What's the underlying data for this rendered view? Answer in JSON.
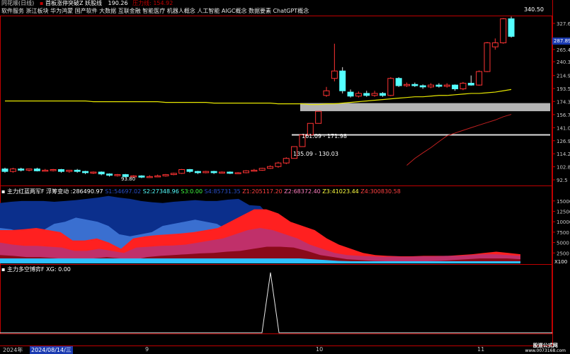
{
  "header": {
    "app_title": "同花顺(日线)",
    "stock_title": "首板涨停突破Z 妖股线",
    "value1": "190.26",
    "value2_label": "压力线",
    "value2": "154.92",
    "concepts": "软件服务 浙江板块 华为鸿蒙 国产软件 大数据 互联金融 智能医疗 机器人概念 人工智能 AIGC概念 数据要素 ChatGPT概念"
  },
  "colors": {
    "up": "#ff3333",
    "down": "#54ffff",
    "ma_yellow": "#e6e600",
    "ma_red": "#c02020",
    "band_gray": "#b4b4b4",
    "axis": "#c00000"
  },
  "price_axis": {
    "ticks": [
      "327.6",
      "287.89",
      "265.4",
      "240.3",
      "214.9",
      "193.5",
      "174.3",
      "156.7",
      "141.0",
      "126.9",
      "114.2",
      "102.8",
      "92.5"
    ],
    "current": "287.89"
  },
  "annotations": {
    "high_label": "340.50",
    "low_label": "93.80",
    "band1": "161.09 - 171.98",
    "band2": "135.09 - 130.03"
  },
  "indicator1": {
    "title": "主力红蓝两军F",
    "subtitle": "浮筹变动",
    "v0": "286490.97",
    "s1_label": "S1",
    "s1": "54697.02",
    "s2_label": "S2",
    "s2": "27348.96",
    "s3_label": "S3",
    "s3": "0.00",
    "s4_label": "S4",
    "s4": "85731.35",
    "z1_label": "Z1",
    "z1": "205117.20",
    "z2_label": "Z2",
    "z2": "68372.40",
    "z3_label": "Z3",
    "z3": "41023.44",
    "z4_label": "Z4",
    "z4": "300830.58",
    "axis_ticks": [
      "15000",
      "12500",
      "10000",
      "7500",
      "5000",
      "2500"
    ],
    "axis_unit": "X100"
  },
  "indicator2": {
    "title": "主力多空博弈F",
    "xg_label": "XG",
    "xg": "0.00"
  },
  "time_axis": {
    "labels": [
      "2024年",
      "2024/08/14/三",
      "9",
      "10",
      "11"
    ]
  },
  "footer": {
    "line1": "股道公式网",
    "line2": "www.0073168.com"
  },
  "chart_data": {
    "type": "candlestick",
    "title": "首板涨停突破Z 妖股线",
    "candles": [
      {
        "o": 101,
        "c": 99,
        "h": 102,
        "l": 98
      },
      {
        "o": 99,
        "c": 101,
        "h": 102,
        "l": 98
      },
      {
        "o": 101,
        "c": 100,
        "h": 102,
        "l": 99
      },
      {
        "o": 100,
        "c": 101,
        "h": 101,
        "l": 99
      },
      {
        "o": 101,
        "c": 99.5,
        "h": 102,
        "l": 99
      },
      {
        "o": 99.5,
        "c": 100,
        "h": 101,
        "l": 99
      },
      {
        "o": 100,
        "c": 100.5,
        "h": 101,
        "l": 99
      },
      {
        "o": 100.5,
        "c": 99,
        "h": 101,
        "l": 98
      },
      {
        "o": 99,
        "c": 100,
        "h": 100,
        "l": 98
      },
      {
        "o": 100,
        "c": 99,
        "h": 101,
        "l": 98
      },
      {
        "o": 99,
        "c": 98,
        "h": 99.5,
        "l": 97
      },
      {
        "o": 98,
        "c": 98.5,
        "h": 99,
        "l": 97
      },
      {
        "o": 98.5,
        "c": 97,
        "h": 99,
        "l": 96
      },
      {
        "o": 97,
        "c": 96,
        "h": 97.5,
        "l": 95
      },
      {
        "o": 96,
        "c": 96.5,
        "h": 97,
        "l": 95
      },
      {
        "o": 96.5,
        "c": 95,
        "h": 97,
        "l": 94.5
      },
      {
        "o": 95,
        "c": 95.5,
        "h": 96,
        "l": 94
      },
      {
        "o": 95.5,
        "c": 94.5,
        "h": 96,
        "l": 93.8
      },
      {
        "o": 94.5,
        "c": 95,
        "h": 96,
        "l": 94
      },
      {
        "o": 95,
        "c": 95.5,
        "h": 96.5,
        "l": 94.5
      },
      {
        "o": 95.5,
        "c": 96.5,
        "h": 97,
        "l": 95
      },
      {
        "o": 96.5,
        "c": 97.5,
        "h": 98,
        "l": 96
      },
      {
        "o": 97.5,
        "c": 100.5,
        "h": 101,
        "l": 97
      },
      {
        "o": 100.5,
        "c": 99,
        "h": 101,
        "l": 98
      },
      {
        "o": 99,
        "c": 98,
        "h": 99.5,
        "l": 97
      },
      {
        "o": 98,
        "c": 99,
        "h": 99.5,
        "l": 97.5
      },
      {
        "o": 99,
        "c": 98,
        "h": 99.5,
        "l": 97
      },
      {
        "o": 98,
        "c": 98.5,
        "h": 99,
        "l": 97.5
      },
      {
        "o": 98.5,
        "c": 97.5,
        "h": 99,
        "l": 97
      },
      {
        "o": 97.5,
        "c": 98,
        "h": 98.5,
        "l": 97
      },
      {
        "o": 98,
        "c": 99.5,
        "h": 100,
        "l": 97.5
      },
      {
        "o": 99.5,
        "c": 100,
        "h": 101,
        "l": 99
      },
      {
        "o": 100,
        "c": 101.5,
        "h": 102,
        "l": 99.5
      },
      {
        "o": 101.5,
        "c": 103,
        "h": 104,
        "l": 101
      },
      {
        "o": 103,
        "c": 106,
        "h": 107,
        "l": 102
      },
      {
        "o": 106,
        "c": 110,
        "h": 111,
        "l": 105
      },
      {
        "o": 110,
        "c": 121,
        "h": 121,
        "l": 110
      },
      {
        "o": 121,
        "c": 133,
        "h": 133,
        "l": 121
      },
      {
        "o": 133,
        "c": 146,
        "h": 146,
        "l": 133
      },
      {
        "o": 146,
        "c": 161,
        "h": 161,
        "l": 146
      },
      {
        "o": 183,
        "c": 190,
        "h": 196,
        "l": 181
      },
      {
        "o": 210,
        "c": 223,
        "h": 278,
        "l": 205
      },
      {
        "o": 223,
        "c": 190,
        "h": 230,
        "l": 186
      },
      {
        "o": 188,
        "c": 182,
        "h": 192,
        "l": 180
      },
      {
        "o": 182,
        "c": 186,
        "h": 189,
        "l": 180
      },
      {
        "o": 186,
        "c": 183,
        "h": 190,
        "l": 181
      },
      {
        "o": 183,
        "c": 186,
        "h": 190,
        "l": 181
      },
      {
        "o": 186,
        "c": 183,
        "h": 188,
        "l": 181
      },
      {
        "o": 183,
        "c": 210,
        "h": 212,
        "l": 182
      },
      {
        "o": 210,
        "c": 198,
        "h": 212,
        "l": 196
      },
      {
        "o": 198,
        "c": 200,
        "h": 203,
        "l": 196
      },
      {
        "o": 200,
        "c": 198,
        "h": 203,
        "l": 196
      },
      {
        "o": 198,
        "c": 196,
        "h": 200,
        "l": 193
      },
      {
        "o": 196,
        "c": 199,
        "h": 202,
        "l": 194
      },
      {
        "o": 199,
        "c": 197,
        "h": 202,
        "l": 195
      },
      {
        "o": 197,
        "c": 199,
        "h": 202,
        "l": 195
      },
      {
        "o": 199,
        "c": 193,
        "h": 200,
        "l": 190
      },
      {
        "o": 193,
        "c": 202,
        "h": 204,
        "l": 191
      },
      {
        "o": 202,
        "c": 199,
        "h": 215,
        "l": 198
      },
      {
        "o": 199,
        "c": 222,
        "h": 224,
        "l": 198
      },
      {
        "o": 222,
        "c": 280,
        "h": 282,
        "l": 221
      },
      {
        "o": 271,
        "c": 280,
        "h": 290,
        "l": 265
      },
      {
        "o": 280,
        "c": 340,
        "h": 342,
        "l": 278
      },
      {
        "o": 340,
        "c": 295,
        "h": 346,
        "l": 292
      }
    ],
    "ma_yellow": [
      175,
      175,
      175,
      175,
      175,
      175,
      175,
      175,
      175,
      175,
      175,
      174,
      174,
      174,
      174,
      174,
      174,
      174,
      174,
      174,
      173,
      173,
      173,
      173,
      173,
      173,
      172,
      172,
      172,
      172,
      172,
      172,
      172,
      172,
      171,
      171,
      171,
      171,
      170,
      170,
      171,
      171,
      172,
      173,
      174,
      175,
      176,
      177,
      178,
      179,
      180,
      181,
      181,
      182,
      183,
      183,
      184,
      185,
      186,
      186,
      187,
      188,
      190,
      192
    ],
    "ma_red": [
      104,
      110,
      115,
      120,
      126,
      132,
      135,
      138,
      141,
      144,
      147,
      150,
      154,
      157
    ],
    "ylim": [
      92.5,
      345
    ],
    "indicator1_series": {
      "dark_blue": [
        145,
        148,
        150,
        150,
        150,
        148,
        150,
        152,
        155,
        158,
        162,
        158,
        155,
        150,
        147,
        145,
        148,
        150,
        152,
        150,
        150,
        153,
        155,
        140,
        138,
        110,
        100,
        85,
        40,
        35,
        30,
        28,
        25,
        22,
        20,
        18,
        18,
        17,
        17,
        17,
        16,
        16,
        18,
        20,
        22,
        20,
        18,
        16,
        15
      ],
      "light_blue": [
        85,
        82,
        75,
        75,
        80,
        95,
        100,
        110,
        105,
        100,
        90,
        70,
        65,
        70,
        75,
        90,
        95,
        100,
        105,
        100,
        95,
        80,
        60,
        40,
        35,
        30,
        25,
        20,
        18,
        16,
        15,
        14,
        14,
        14,
        13,
        13,
        13,
        13,
        14,
        14,
        14,
        14,
        15,
        15,
        15,
        14,
        13,
        12,
        12
      ],
      "red": [
        80,
        80,
        82,
        85,
        80,
        75,
        55,
        55,
        60,
        50,
        35,
        60,
        65,
        68,
        70,
        72,
        75,
        80,
        85,
        100,
        115,
        130,
        130,
        120,
        100,
        90,
        80,
        60,
        45,
        35,
        25,
        20,
        18,
        17,
        17,
        18,
        18,
        18,
        20,
        22,
        25,
        28,
        25,
        22
      ],
      "pink": [
        50,
        45,
        42,
        42,
        40,
        38,
        30,
        30,
        35,
        30,
        25,
        38,
        40,
        42,
        43,
        45,
        50,
        55,
        60,
        70,
        80,
        85,
        80,
        70,
        60,
        45,
        35,
        25,
        20,
        18,
        17,
        16,
        16,
        16,
        17,
        17,
        18,
        18,
        20,
        22,
        22,
        20,
        18
      ],
      "dark_red": [
        20,
        18,
        15,
        15,
        13,
        10,
        10,
        12,
        15,
        12,
        8,
        15,
        18,
        20,
        22,
        24,
        25,
        28,
        30,
        35,
        40,
        40,
        38,
        30,
        20,
        15,
        10,
        8,
        6,
        5,
        5,
        5,
        5,
        6,
        8,
        10,
        12,
        12,
        12,
        10
      ],
      "cyan": [
        12,
        12,
        12,
        12,
        12,
        12,
        12,
        12,
        12,
        12,
        12,
        12,
        12,
        12,
        12,
        12,
        12,
        12,
        12,
        12,
        12,
        12,
        12,
        12,
        10,
        8,
        6,
        5,
        5,
        5,
        5,
        5,
        5,
        5,
        5,
        5,
        5,
        5,
        5,
        5,
        5
      ]
    },
    "indicator2_spike": {
      "index": 49,
      "value": 1
    }
  }
}
